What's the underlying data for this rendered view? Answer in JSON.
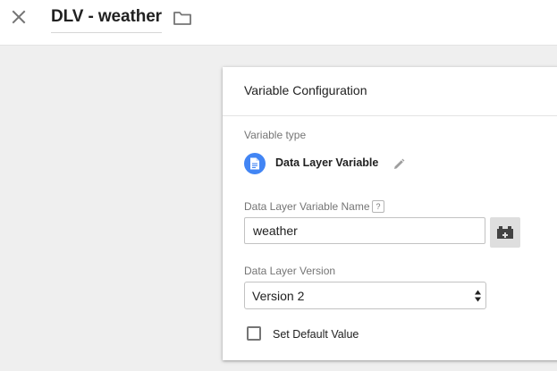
{
  "header": {
    "title": "DLV - weather",
    "close_icon": "close-icon",
    "folder_icon": "folder-icon"
  },
  "panel": {
    "title": "Variable Configuration",
    "variable_type": {
      "label": "Variable type",
      "value": "Data Layer Variable",
      "icon": "document-icon",
      "icon_color": "#4285f4",
      "edit_icon": "pencil-icon"
    },
    "name_field": {
      "label": "Data Layer Variable Name",
      "help": "?",
      "value": "weather",
      "picker_icon": "variable-brick-icon"
    },
    "version_field": {
      "label": "Data Layer Version",
      "selected": "Version 2"
    },
    "default_value": {
      "label": "Set Default Value",
      "checked": false
    }
  },
  "colors": {
    "background": "#efefef",
    "panel": "#ffffff",
    "accent": "#4285f4"
  }
}
